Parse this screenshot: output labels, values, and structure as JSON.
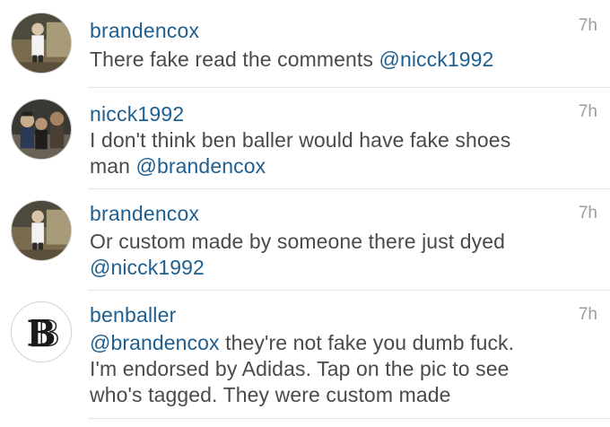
{
  "comments": [
    {
      "username": "brandencox",
      "time": "7h",
      "lines": [
        {
          "text": "There fake read the comments ",
          "mention": "@nicck1992"
        }
      ],
      "avatar_icon": "user-photo-avatar"
    },
    {
      "username": "nicck1992",
      "time": "7h",
      "lines": [
        {
          "text": "I don't think ben baller would have fake shoes",
          "mention": ""
        },
        {
          "text": "man ",
          "mention": "@brandencox"
        }
      ],
      "avatar_icon": "group-photo-avatar"
    },
    {
      "username": "brandencox",
      "time": "7h",
      "lines": [
        {
          "text": "Or custom made by someone there just dyed",
          "mention": ""
        },
        {
          "text": "",
          "mention": "@nicck1992"
        }
      ],
      "avatar_icon": "user-photo-avatar"
    },
    {
      "username": "benballer",
      "time": "7h",
      "lines": [
        {
          "mention": "@brandencox",
          "text": " they're not fake you dumb fuck."
        },
        {
          "text": "I'm endorsed by Adidas. Tap on the pic to see",
          "mention": ""
        },
        {
          "text": "who's tagged. They were custom made",
          "mention": ""
        }
      ],
      "avatar_icon": "bb-logo-avatar"
    }
  ],
  "colors": {
    "username": "#1f5f8f",
    "body_text": "#4a4a4a",
    "timestamp": "#9c9c9c",
    "divider": "#e3e3e3"
  }
}
